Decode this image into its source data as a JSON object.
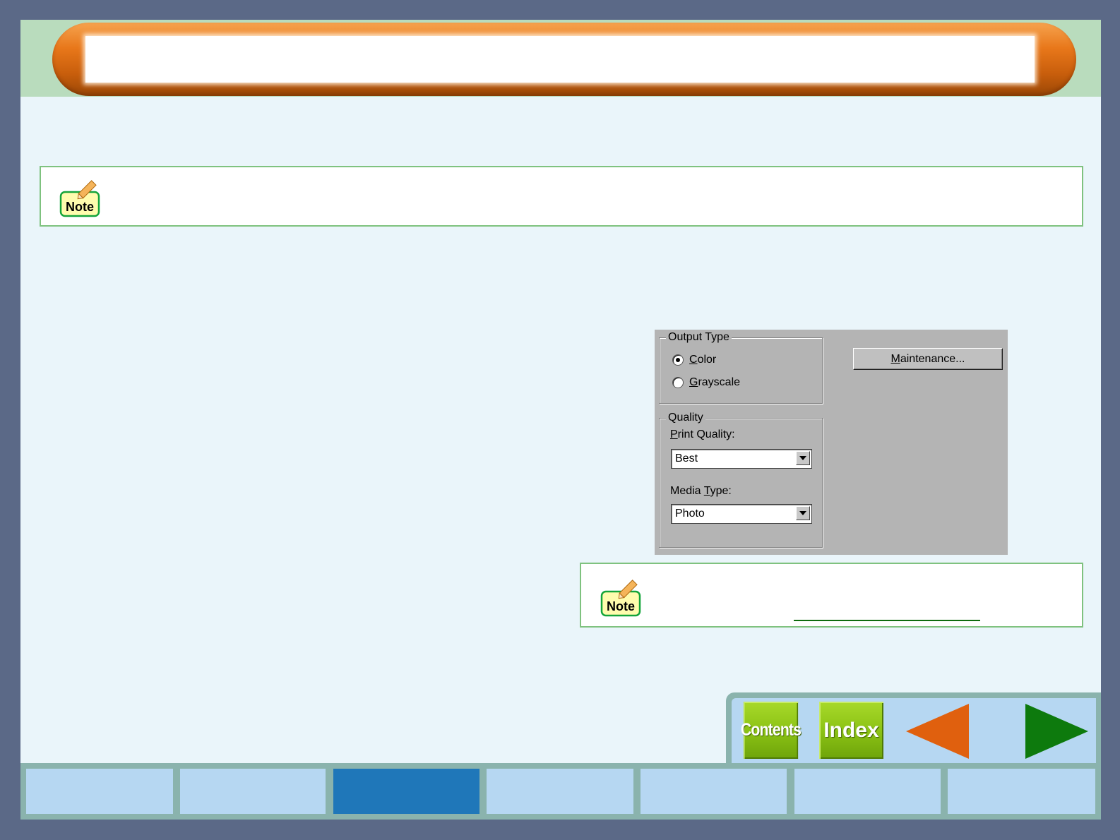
{
  "header": {
    "title": ""
  },
  "note_top": {
    "icon_label": "Note",
    "text": ""
  },
  "dialog": {
    "output_type": {
      "legend": "Output Type",
      "options": [
        {
          "label": "Color",
          "accel": "C",
          "rest": "olor",
          "selected": true
        },
        {
          "label": "Grayscale",
          "accel": "G",
          "rest": "rayscale",
          "selected": false
        }
      ]
    },
    "quality": {
      "legend": "Quality",
      "print_quality_label_accel": "P",
      "print_quality_label_rest": "rint Quality:",
      "print_quality_value": "Best",
      "media_type_label_pre": "Media ",
      "media_type_label_accel": "T",
      "media_type_label_rest": "ype:",
      "media_type_value": "Photo"
    },
    "maintenance_accel": "M",
    "maintenance_rest": "aintenance..."
  },
  "note_bottom": {
    "icon_label": "Note",
    "text": ""
  },
  "nav": {
    "contents_label": "Contents",
    "index_label": "Index",
    "prev_icon": "triangle-left-icon",
    "next_icon": "triangle-right-icon"
  },
  "tabs": {
    "count": 7,
    "active_index": 2
  },
  "colors": {
    "accent_orange": "#e8771a",
    "nav_green": "#8cc315",
    "active_tab": "#1f77b9",
    "tab": "#b6d7f2"
  }
}
